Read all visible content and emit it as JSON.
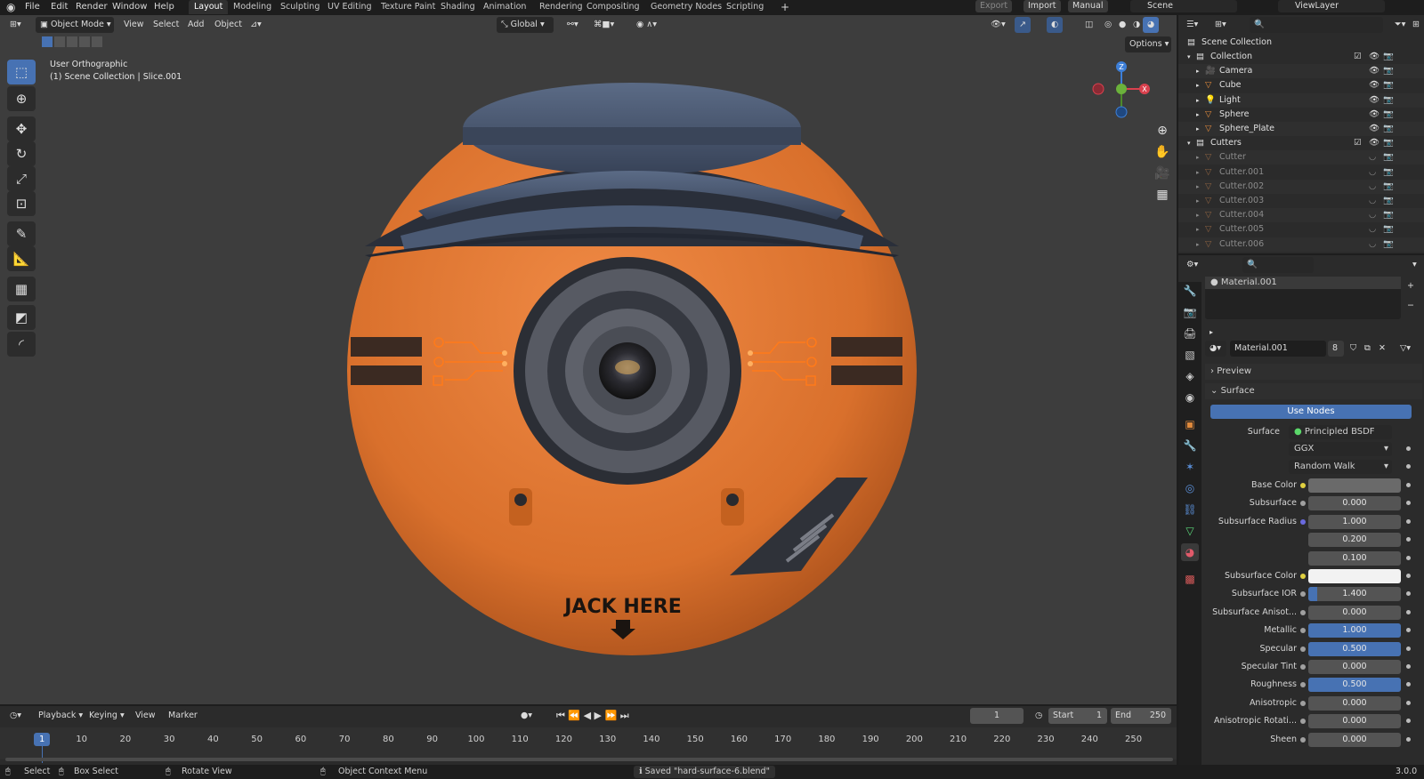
{
  "menu": {
    "file": "File",
    "edit": "Edit",
    "render": "Render",
    "window": "Window",
    "help": "Help"
  },
  "workspaces": [
    "Layout",
    "Modeling",
    "Sculpting",
    "UV Editing",
    "Texture Paint",
    "Shading",
    "Animation",
    "Rendering",
    "Compositing",
    "Geometry Nodes",
    "Scripting"
  ],
  "topright": {
    "export": "Export",
    "import": "Import",
    "manual": "Manual",
    "scene": "Scene",
    "viewlayer": "ViewLayer"
  },
  "viewport": {
    "mode": "Object Mode",
    "view": "View",
    "select": "Select",
    "add": "Add",
    "object": "Object",
    "orientation": "Global",
    "options": "Options",
    "overlay_title": "User Orthographic",
    "overlay_sub": "(1) Scene Collection | Slice.001",
    "model_text": "JACK HERE",
    "gizmo": {
      "z": "Z",
      "y": "Y",
      "x": "X"
    },
    "colors": {
      "body": "#e07a35",
      "cap": "#4a5870",
      "background": "#3d3d3d"
    }
  },
  "timeline": {
    "playback": "Playback",
    "keying": "Keying",
    "view": "View",
    "marker": "Marker",
    "current_frame": "1",
    "start_label": "Start",
    "start": "1",
    "end_label": "End",
    "end": "250",
    "ticks": [
      "1",
      "10",
      "20",
      "30",
      "40",
      "50",
      "60",
      "70",
      "80",
      "90",
      "100",
      "110",
      "120",
      "130",
      "140",
      "150",
      "160",
      "170",
      "180",
      "190",
      "200",
      "210",
      "220",
      "230",
      "240",
      "250"
    ]
  },
  "statusbar": {
    "select": "Select",
    "box_select": "Box Select",
    "rotate": "Rotate View",
    "context": "Object Context Menu",
    "message": "Saved \"hard-surface-6.blend\"",
    "version": "3.0.0"
  },
  "outliner": {
    "root": "Scene Collection",
    "rows": [
      {
        "name": "Collection",
        "kind": "collection"
      },
      {
        "name": "Camera",
        "kind": "camera"
      },
      {
        "name": "Cube",
        "kind": "mesh"
      },
      {
        "name": "Light",
        "kind": "light"
      },
      {
        "name": "Sphere",
        "kind": "mesh"
      },
      {
        "name": "Sphere_Plate",
        "kind": "mesh"
      },
      {
        "name": "Cutters",
        "kind": "collection"
      },
      {
        "name": "Cutter",
        "kind": "mesh"
      },
      {
        "name": "Cutter.001",
        "kind": "mesh"
      },
      {
        "name": "Cutter.002",
        "kind": "mesh"
      },
      {
        "name": "Cutter.003",
        "kind": "mesh"
      },
      {
        "name": "Cutter.004",
        "kind": "mesh"
      },
      {
        "name": "Cutter.005",
        "kind": "mesh"
      },
      {
        "name": "Cutter.006",
        "kind": "mesh"
      }
    ]
  },
  "properties": {
    "slot": "Material.001",
    "material": "Material.001",
    "users": "8",
    "preview": "Preview",
    "surface_panel": "Surface",
    "use_nodes": "Use Nodes",
    "surface_label": "Surface",
    "surface_value": "Principled BSDF",
    "distribution": "GGX",
    "subsurface_method": "Random Walk",
    "fields": [
      {
        "label": "Base Color",
        "value": "",
        "fill": 0,
        "kind": "color",
        "color": "#6a6a6a"
      },
      {
        "label": "Subsurface",
        "value": "0.000",
        "fill": 0
      },
      {
        "label": "Subsurface Radius",
        "value": "1.000",
        "fill": 0
      },
      {
        "label": "",
        "value": "0.200",
        "fill": 0
      },
      {
        "label": "",
        "value": "0.100",
        "fill": 0
      },
      {
        "label": "Subsurface Color",
        "value": "",
        "fill": 0,
        "kind": "color",
        "color": "#f2f2f2"
      },
      {
        "label": "Subsurface IOR",
        "value": "1.400",
        "fill": 0.1
      },
      {
        "label": "Subsurface Anisot...",
        "value": "0.000",
        "fill": 0
      },
      {
        "label": "Metallic",
        "value": "1.000",
        "fill": 1
      },
      {
        "label": "Specular",
        "value": "0.500",
        "fill": 1
      },
      {
        "label": "Specular Tint",
        "value": "0.000",
        "fill": 0
      },
      {
        "label": "Roughness",
        "value": "0.500",
        "fill": 1
      },
      {
        "label": "Anisotropic",
        "value": "0.000",
        "fill": 0
      },
      {
        "label": "Anisotropic Rotati...",
        "value": "0.000",
        "fill": 0
      },
      {
        "label": "Sheen",
        "value": "0.000",
        "fill": 0
      }
    ]
  }
}
